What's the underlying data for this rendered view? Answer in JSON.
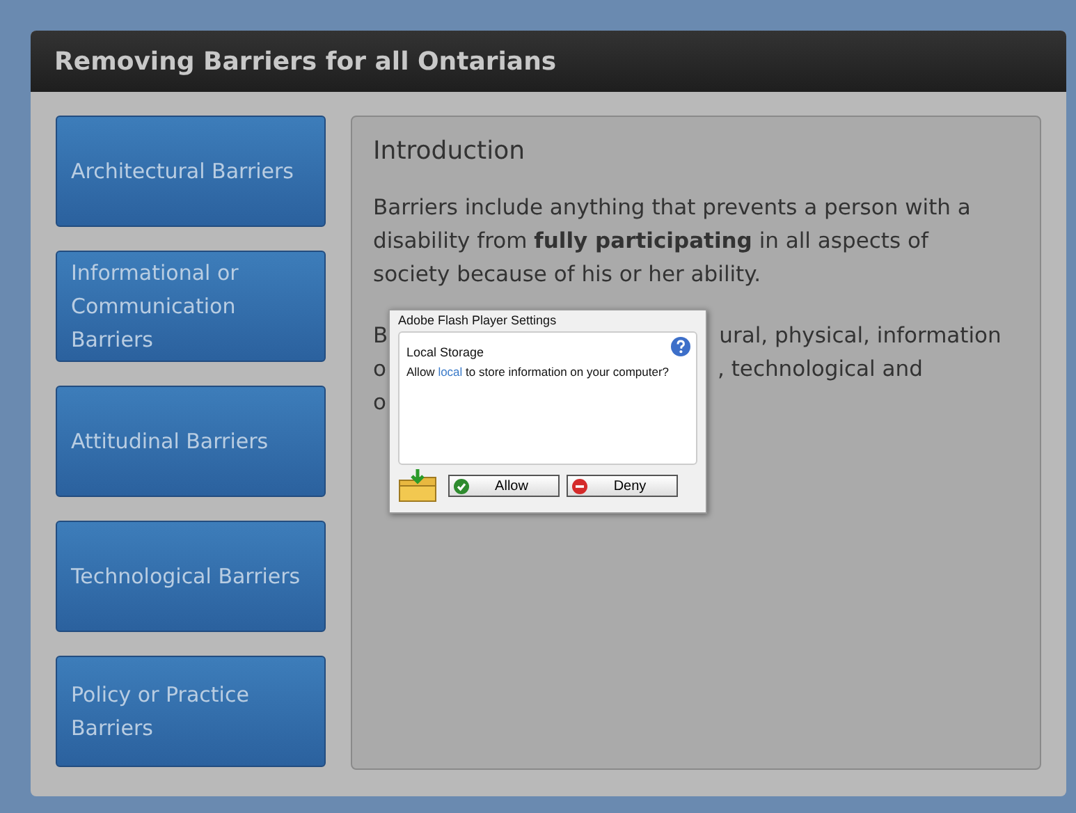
{
  "header": {
    "title": "Removing Barriers for all Ontarians"
  },
  "sidebar": {
    "items": [
      {
        "label": "Architectural Barriers"
      },
      {
        "label": "Informational or Communication Barriers"
      },
      {
        "label": "Attitudinal Barriers"
      },
      {
        "label": "Technological Barriers"
      },
      {
        "label": "Policy or Practice Barriers"
      }
    ]
  },
  "content": {
    "heading": "Introduction",
    "paragraph": "Barriers include anything that prevents a person with a disability from **fully participating** in all aspects of society because of his or her ability.",
    "partly_hidden_lines": [
      {
        "left": "B",
        "right": "ural, physical, information"
      },
      {
        "left": "o",
        "right": ", technological and"
      },
      {
        "left": "o"
      }
    ]
  },
  "dialog": {
    "title": "Adobe Flash Player Settings",
    "section": "Local Storage",
    "message_before": "Allow",
    "link": "local",
    "message_after": "to store information on your computer?",
    "buttons": [
      {
        "kind": "allow",
        "label": "Allow"
      },
      {
        "kind": "deny",
        "label": "Deny"
      }
    ]
  }
}
